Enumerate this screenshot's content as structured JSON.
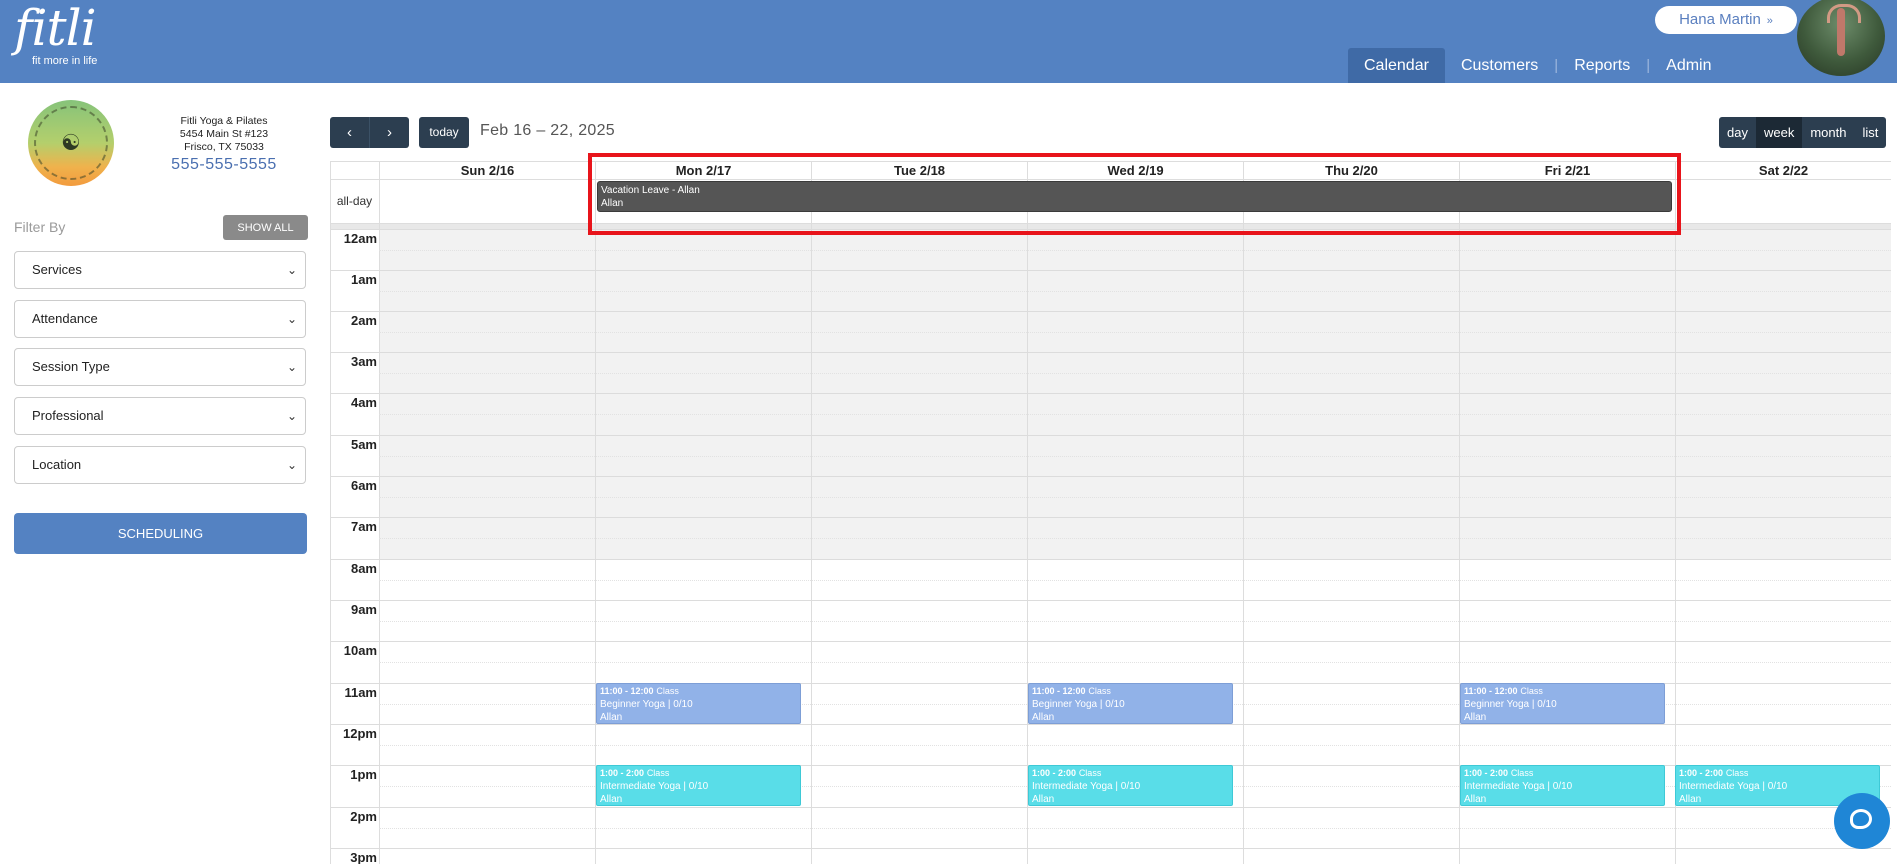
{
  "header": {
    "logo_word": "fitli",
    "logo_tagline": "fit more in life",
    "user_name": "Hana Martin",
    "nav": [
      "Calendar",
      "Customers",
      "Reports",
      "Admin"
    ]
  },
  "studio": {
    "name": "Fitli Yoga & Pilates",
    "address_line1": "5454 Main St #123",
    "address_line2": "Frisco, TX 75033",
    "phone": "555-555-5555"
  },
  "filters": {
    "label": "Filter By",
    "show_all": "SHOW ALL",
    "selects": [
      "Services",
      "Attendance",
      "Session Type",
      "Professional",
      "Location"
    ],
    "scheduling": "SCHEDULING"
  },
  "toolbar": {
    "prev": "‹",
    "next": "›",
    "today": "today",
    "range": "Feb 16 – 22, 2025",
    "views": [
      "day",
      "week",
      "month",
      "list"
    ],
    "active_view": "week"
  },
  "calendar": {
    "days": [
      "Sun 2/16",
      "Mon 2/17",
      "Tue 2/18",
      "Wed 2/19",
      "Thu 2/20",
      "Fri 2/21",
      "Sat 2/22"
    ],
    "allday_label": "all-day",
    "hours": [
      "12am",
      "1am",
      "2am",
      "3am",
      "4am",
      "5am",
      "6am",
      "7am",
      "8am",
      "9am",
      "10am",
      "11am",
      "12pm",
      "1pm",
      "2pm",
      "3pm"
    ],
    "vacation": {
      "title": "Vacation Leave - Allan",
      "person": "Allan"
    },
    "events": [
      {
        "time": "11:00 - 12:00",
        "kind": "Class",
        "title": "Beginner Yoga | 0/10",
        "person": "Allan"
      },
      {
        "time": "11:00 - 12:00",
        "kind": "Class",
        "title": "Beginner Yoga | 0/10",
        "person": "Allan"
      },
      {
        "time": "11:00 - 12:00",
        "kind": "Class",
        "title": "Beginner Yoga | 0/10",
        "person": "Allan"
      },
      {
        "time": "1:00 - 2:00",
        "kind": "Class",
        "title": "Intermediate Yoga | 0/10",
        "person": "Allan"
      },
      {
        "time": "1:00 - 2:00",
        "kind": "Class",
        "title": "Intermediate Yoga | 0/10",
        "person": "Allan"
      },
      {
        "time": "1:00 - 2:00",
        "kind": "Class",
        "title": "Intermediate Yoga | 0/10",
        "person": "Allan"
      },
      {
        "time": "1:00 - 2:00",
        "kind": "Class",
        "title": "Intermediate Yoga | 0/10",
        "person": "Allan"
      }
    ]
  },
  "colors": {
    "header": "#5482c2",
    "toolbar_button": "#2c3e50",
    "class_beginner": "#91b2e8",
    "class_intermediate": "#59dde8",
    "vacation": "#555555",
    "highlight": "#e8141b",
    "chat": "#1f86d6"
  },
  "icons": {
    "chat": "chat-bubble-icon",
    "dropdown": "chevron-down-icon"
  }
}
